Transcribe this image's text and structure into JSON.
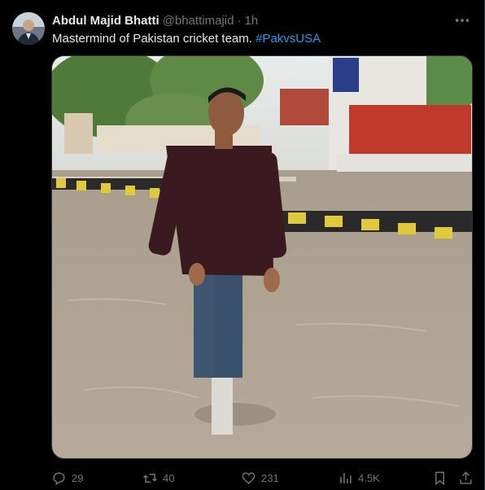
{
  "post": {
    "author_name": "Abdul Majid Bhatti",
    "handle": "@bhattimajid",
    "separator": "·",
    "time": "1h",
    "text": "Mastermind of Pakistan cricket team.",
    "hashtag": "#PakvsUSA"
  },
  "actions": {
    "replies": "29",
    "reposts": "40",
    "likes": "231",
    "views": "4.5K"
  },
  "icons": {
    "more": "more-horizontal-icon",
    "reply": "reply-icon",
    "repost": "repost-icon",
    "like": "heart-icon",
    "views": "views-icon",
    "bookmark": "bookmark-icon",
    "share": "share-icon"
  },
  "colors": {
    "background": "#000000",
    "text_primary": "#e7e9ea",
    "text_secondary": "#71767b",
    "link": "#1d9bf0"
  }
}
